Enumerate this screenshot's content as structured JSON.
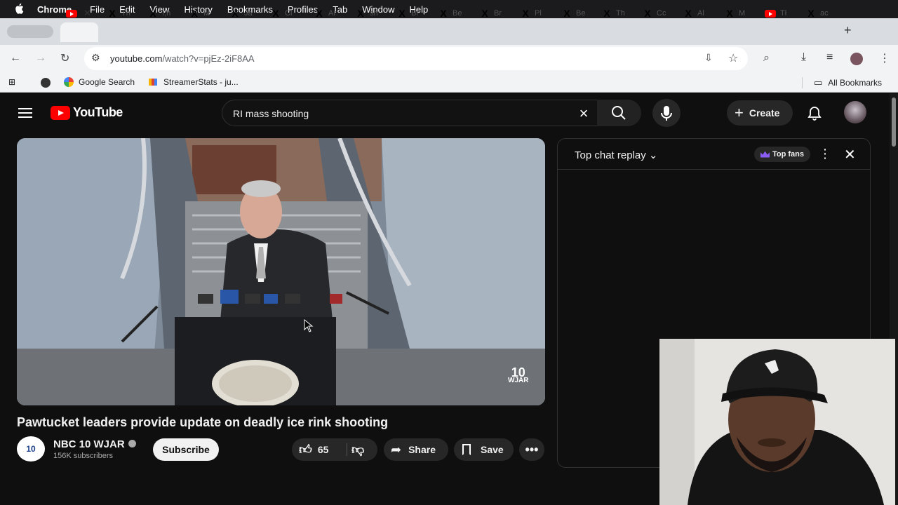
{
  "menubar": {
    "app": "Chrome",
    "items": [
      "File",
      "Edit",
      "View",
      "History",
      "Bookmarks",
      "Profiles",
      "Tab",
      "Window",
      "Help"
    ]
  },
  "tabs": [
    {
      "label": "Th"
    },
    {
      "label": "I,h"
    },
    {
      "label": "M"
    },
    {
      "label": "Ja"
    },
    {
      "label": "Cl"
    },
    {
      "label": "Ar"
    },
    {
      "label": "sh"
    },
    {
      "label": "Br"
    },
    {
      "label": "Be"
    },
    {
      "label": "Br"
    },
    {
      "label": "Pl"
    },
    {
      "label": "Be"
    },
    {
      "label": "Th"
    },
    {
      "label": "Cc"
    },
    {
      "label": "Al"
    },
    {
      "label": "M"
    },
    {
      "label": "Tł"
    },
    {
      "label": "ac"
    }
  ],
  "address": {
    "host": "youtube.com",
    "path": "/watch?v=pjEz-2iF8AA"
  },
  "bookmarks": {
    "google": "Google Search",
    "streamer": "StreamerStats - ju...",
    "all": "All Bookmarks"
  },
  "youtube": {
    "logo": "YouTube",
    "search_query": "RI mass shooting",
    "create_label": "Create",
    "video_title": "Pawtucket leaders provide update on deadly ice rink shooting",
    "channel_name": "NBC 10 WJAR",
    "channel_avatar": "10",
    "subscribers": "156K subscribers",
    "subscribe_label": "Subscribe",
    "likes": "65",
    "share_label": "Share",
    "save_label": "Save",
    "watermark_top": "10",
    "watermark_bottom": "WJAR"
  },
  "chat": {
    "title": "Top chat replay",
    "top_fans_label": "Top fans"
  },
  "colors": {
    "yt_red": "#ff0000",
    "yt_bg": "#0f0f0f",
    "chrome_toolbar": "#f1f3f4"
  }
}
